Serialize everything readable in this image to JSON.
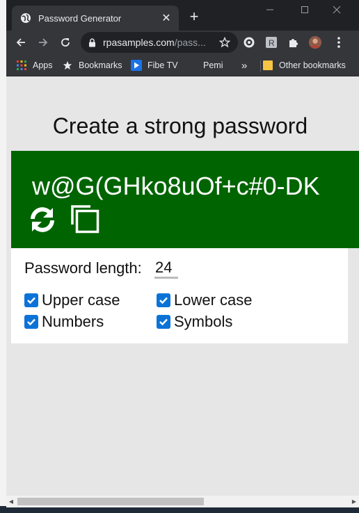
{
  "browser": {
    "tab_title": "Password Generator",
    "tab_close": "✕",
    "new_tab": "+",
    "url_host": "rpasamples.com",
    "url_path": "/pass...",
    "window_controls": [
      "minimize-icon",
      "maximize-icon",
      "close-icon"
    ]
  },
  "bookmarks": {
    "apps": "Apps",
    "bookmarks": "Bookmarks",
    "fibe_tv": "Fibe TV",
    "pemi": "Pemi",
    "overflow": "»",
    "other": "Other bookmarks"
  },
  "page": {
    "heading": "Create a strong password",
    "password": "w@G(GHko8uOf+c#0-DK",
    "length_label": "Password length:",
    "length_value": "24",
    "options": [
      {
        "label": "Upper case",
        "checked": true
      },
      {
        "label": "Lower case",
        "checked": true
      },
      {
        "label": "Numbers",
        "checked": true
      },
      {
        "label": "Symbols",
        "checked": true
      }
    ]
  },
  "colors": {
    "password_panel": "#006400",
    "checkbox": "#0b73d8",
    "page_bg": "#e6e6e6",
    "chrome_dark": "#202124"
  },
  "icons": [
    "globe-icon",
    "lock-icon",
    "star-icon",
    "refresh-icon",
    "copy-icon",
    "apps-grid-icon",
    "folder-icon",
    "extensions-icon",
    "profile-avatar",
    "menu-icon",
    "back-icon",
    "forward-icon",
    "reload-icon"
  ]
}
